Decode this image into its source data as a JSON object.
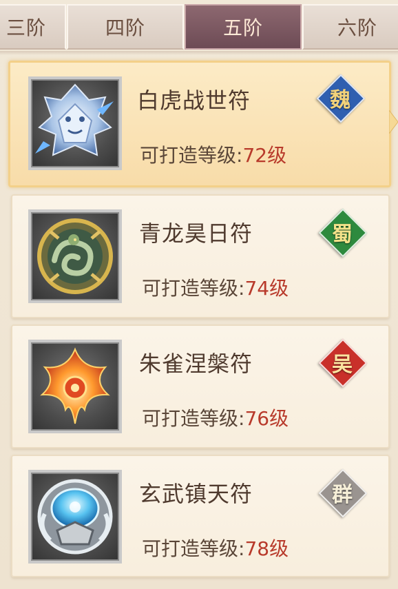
{
  "tabs": [
    {
      "label": "三阶",
      "active": false
    },
    {
      "label": "四阶",
      "active": false
    },
    {
      "label": "五阶",
      "active": true
    },
    {
      "label": "六阶",
      "active": false
    }
  ],
  "level_prefix": "可打造等级:",
  "items": [
    {
      "name": "白虎战世符",
      "level": "72级",
      "faction": "魏",
      "faction_color": "#2f5fb0",
      "faction_text_color": "#f2d27a",
      "icon": "white-tiger-emblem-icon",
      "selected": true
    },
    {
      "name": "青龙昊日符",
      "level": "74级",
      "faction": "蜀",
      "faction_color": "#2e8a3e",
      "faction_text_color": "#f3e28a",
      "icon": "azure-dragon-emblem-icon",
      "selected": false
    },
    {
      "name": "朱雀涅槃符",
      "level": "76级",
      "faction": "吴",
      "faction_color": "#c9302a",
      "faction_text_color": "#fbe3a0",
      "icon": "vermilion-bird-emblem-icon",
      "selected": false
    },
    {
      "name": "玄武镇天符",
      "level": "78级",
      "faction": "群",
      "faction_color": "#9a9490",
      "faction_text_color": "#f6efd8",
      "icon": "black-tortoise-emblem-icon",
      "selected": false
    }
  ]
}
